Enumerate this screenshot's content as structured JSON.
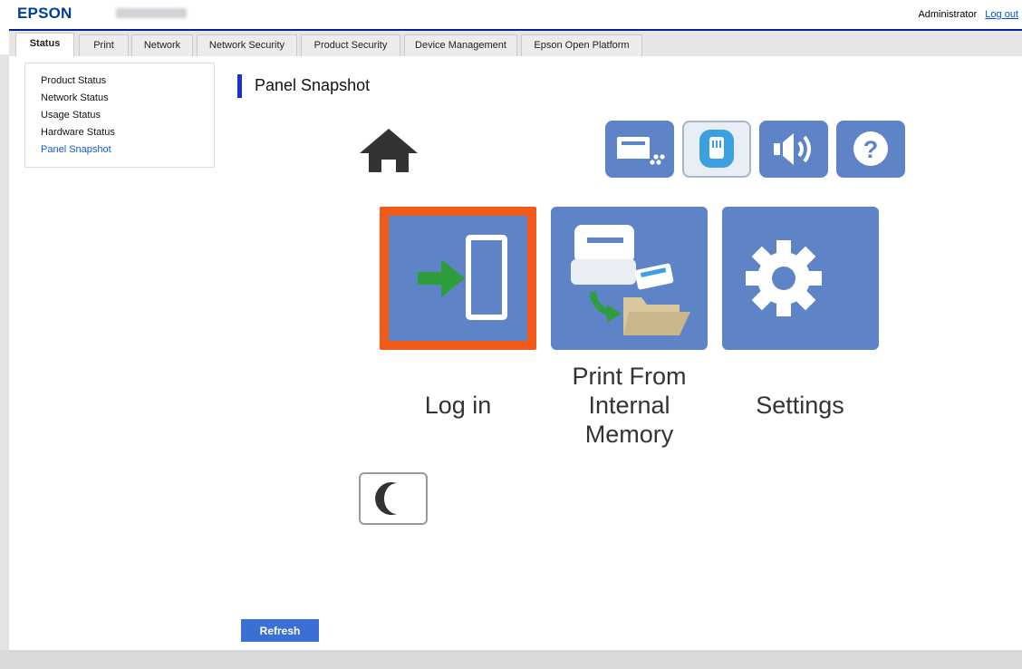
{
  "header": {
    "logo": "EPSON",
    "user": "Administrator",
    "logout": "Log out"
  },
  "tabs": [
    {
      "label": "Status",
      "active": true
    },
    {
      "label": "Print"
    },
    {
      "label": "Network"
    },
    {
      "label": "Network Security"
    },
    {
      "label": "Product Security"
    },
    {
      "label": "Device Management"
    },
    {
      "label": "Epson Open Platform"
    }
  ],
  "sidebar": {
    "items": [
      {
        "label": "Product Status"
      },
      {
        "label": "Network Status"
      },
      {
        "label": "Usage Status"
      },
      {
        "label": "Hardware Status"
      },
      {
        "label": "Panel Snapshot",
        "active": true
      }
    ]
  },
  "main": {
    "title": "Panel Snapshot",
    "panel": {
      "status_icons": [
        "home-icon",
        "printer-status-icon",
        "network-icon",
        "volume-icon",
        "help-icon"
      ],
      "tiles": [
        {
          "icon": "login-icon",
          "label": "Log in",
          "focused": true
        },
        {
          "icon": "print-from-memory-icon",
          "label_lines": [
            "Print From",
            "Internal",
            "Memory"
          ]
        },
        {
          "icon": "settings-gear-icon",
          "label": "Settings"
        }
      ],
      "sleep_icon": "moon-icon"
    },
    "refresh": "Refresh"
  },
  "colors": {
    "brand": "#003f98",
    "tile": "#5e84c7",
    "focus": "#f25a1a",
    "button": "#3b6fd3",
    "active_link": "#1557d6"
  }
}
